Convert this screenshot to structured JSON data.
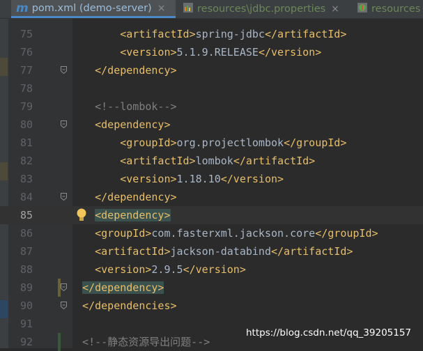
{
  "tabs": [
    {
      "label": "pom.xml (demo-server)",
      "icon": "maven-file-icon",
      "active": true,
      "close": "×"
    },
    {
      "label": "resources\\jdbc.properties",
      "icon": "properties-file-icon",
      "active": false,
      "close": "×"
    },
    {
      "label": "resources",
      "icon": "spring-config-file-icon",
      "active": false,
      "close": ""
    }
  ],
  "editor": {
    "current_line": 85,
    "lines": [
      {
        "num": "75",
        "parts": [
          [
            "tag",
            "        <artifactId>"
          ],
          [
            "txt",
            "spring-jdbc"
          ],
          [
            "tag",
            "</artifactId>"
          ]
        ]
      },
      {
        "num": "76",
        "parts": [
          [
            "tag",
            "        <version>"
          ],
          [
            "txt",
            "5.1.9.RELEASE"
          ],
          [
            "tag",
            "</version>"
          ]
        ]
      },
      {
        "num": "77",
        "parts": [
          [
            "tag",
            "    </dependency>"
          ]
        ]
      },
      {
        "num": "78",
        "parts": []
      },
      {
        "num": "79",
        "parts": [
          [
            "cmt",
            "    <!--lombok-->"
          ]
        ]
      },
      {
        "num": "80",
        "parts": [
          [
            "tag",
            "    <dependency>"
          ]
        ]
      },
      {
        "num": "81",
        "parts": [
          [
            "tag",
            "        <groupId>"
          ],
          [
            "txt",
            "org.projectlombok"
          ],
          [
            "tag",
            "</groupId>"
          ]
        ]
      },
      {
        "num": "82",
        "parts": [
          [
            "tag",
            "        <artifactId>"
          ],
          [
            "txt",
            "lombok"
          ],
          [
            "tag",
            "</artifactId>"
          ]
        ]
      },
      {
        "num": "83",
        "parts": [
          [
            "tag",
            "        <version>"
          ],
          [
            "txt",
            "1.18.10"
          ],
          [
            "tag",
            "</version>"
          ]
        ]
      },
      {
        "num": "84",
        "parts": [
          [
            "tag",
            "    </dependency>"
          ]
        ]
      },
      {
        "num": "85",
        "parts": [
          [
            "tag",
            "    "
          ],
          [
            "hl",
            "<dependency>"
          ]
        ]
      },
      {
        "num": "86",
        "parts": [
          [
            "tag",
            "    <groupId>"
          ],
          [
            "txt",
            "com.fasterxml.jackson.core"
          ],
          [
            "tag",
            "</groupId>"
          ]
        ]
      },
      {
        "num": "87",
        "parts": [
          [
            "tag",
            "    <artifactId>"
          ],
          [
            "txt",
            "jackson-databind"
          ],
          [
            "tag",
            "</artifactId>"
          ]
        ]
      },
      {
        "num": "88",
        "parts": [
          [
            "tag",
            "    <version>"
          ],
          [
            "txt",
            "2.9.5"
          ],
          [
            "tag",
            "</version>"
          ]
        ]
      },
      {
        "num": "89",
        "parts": [
          [
            "tag",
            "  "
          ],
          [
            "hl",
            "</dependency>"
          ]
        ]
      },
      {
        "num": "90",
        "parts": [
          [
            "tag",
            "  </dependencies>"
          ]
        ]
      },
      {
        "num": "91",
        "parts": []
      },
      {
        "num": "92",
        "parts": [
          [
            "cmt",
            "  <!--静态资源导出问题-->"
          ]
        ]
      }
    ]
  },
  "watermark": "https://blog.csdn.net/qq_39205157",
  "colors": {
    "background": "#2b2b2b",
    "gutter": "#313335",
    "tag": "#e8bf6a",
    "text": "#a9b7c6",
    "comment": "#808080",
    "line_number": "#606366",
    "active_tab": "#9cbddb",
    "inactive_tab": "#6a8759",
    "match_highlight": "#3b514d"
  }
}
